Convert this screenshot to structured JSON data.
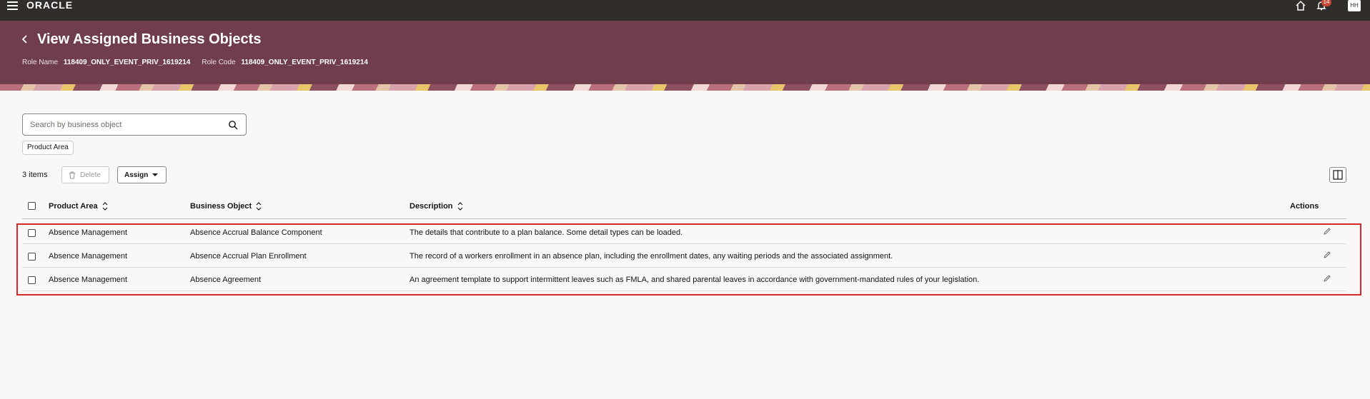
{
  "topbar": {
    "logo": "ORACLE",
    "notification_count": "14",
    "avatar_initials": "HH",
    "icons": [
      "menu-icon",
      "home-icon",
      "bell-icon"
    ]
  },
  "header": {
    "title": "View Assigned Business Objects",
    "role_name_label": "Role Name",
    "role_name_value": "118409_ONLY_EVENT_PRIV_1619214",
    "role_code_label": "Role Code",
    "role_code_value": "118409_ONLY_EVENT_PRIV_1619214"
  },
  "search": {
    "placeholder": "Search by business object",
    "value": ""
  },
  "filter_chip": "Product Area",
  "toolbar": {
    "item_count": "3 items",
    "delete_label": "Delete",
    "assign_label": "Assign"
  },
  "table": {
    "columns": [
      "Product Area",
      "Business Object",
      "Description",
      "Actions"
    ],
    "rows": [
      {
        "product_area": "Absence Management",
        "business_object": "Absence Accrual Balance Component",
        "description": "The details that contribute to a plan balance. Some detail types can be loaded."
      },
      {
        "product_area": "Absence Management",
        "business_object": "Absence Accrual Plan Enrollment",
        "description": "The record of a workers enrollment in an absence plan, including the enrollment dates, any waiting periods and the associated assignment."
      },
      {
        "product_area": "Absence Management",
        "business_object": "Absence Agreement",
        "description": "An agreement template to support intermittent leaves such as FMLA, and shared parental leaves in accordance with government-mandated rules of your legislation."
      }
    ]
  },
  "colors": {
    "topbar": "#312d2a",
    "header_band": "#6f3d4b",
    "highlight_border": "#d62a2a",
    "badge": "#c74634"
  }
}
